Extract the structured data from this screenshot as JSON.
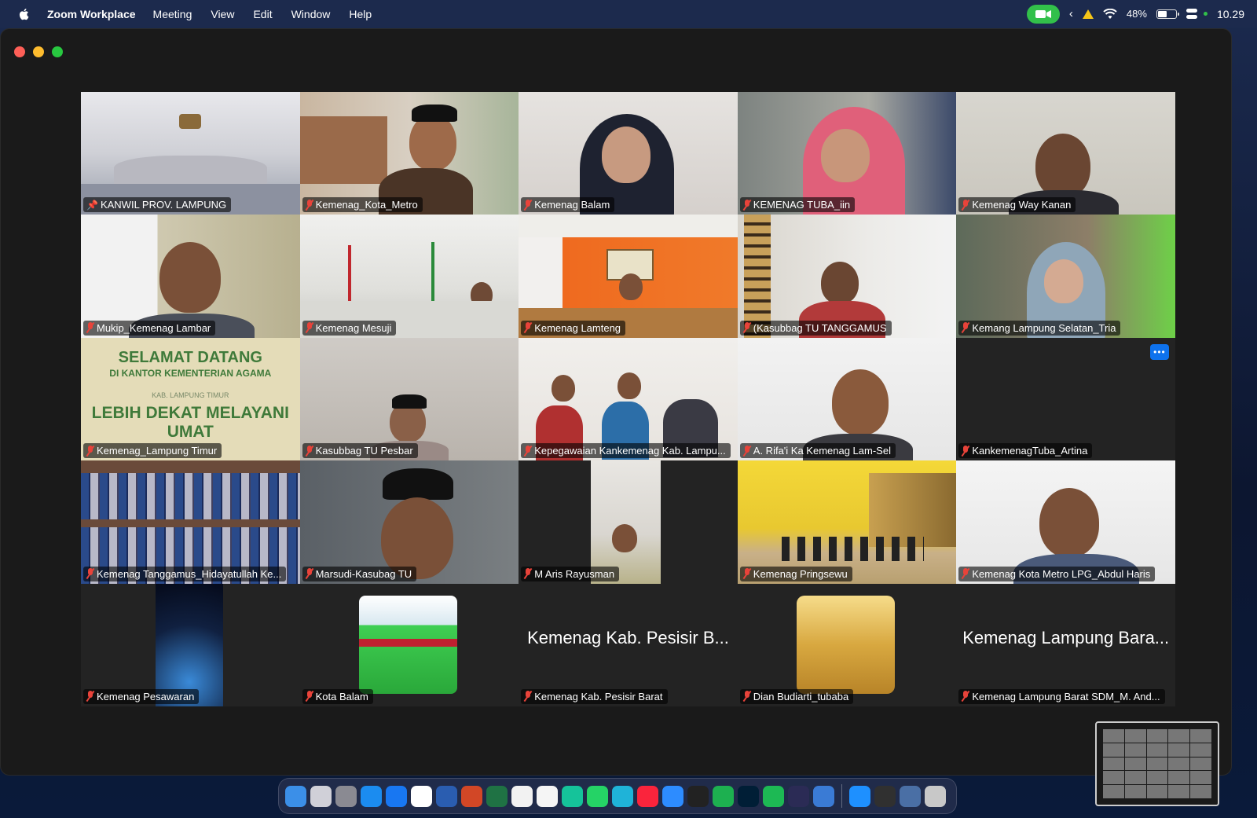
{
  "menubar": {
    "app_name": "Zoom Workplace",
    "items": [
      "Meeting",
      "View",
      "Edit",
      "Window",
      "Help"
    ],
    "battery": "48%",
    "time": "10.29"
  },
  "participants": [
    {
      "name": "KANWIL PROV. LAMPUNG",
      "pinned": true,
      "muted": false,
      "active": true
    },
    {
      "name": "Kemenag_Kota_Metro",
      "muted": true
    },
    {
      "name": "Kemenag Balam",
      "muted": true
    },
    {
      "name": "KEMENAG TUBA_iin",
      "muted": true
    },
    {
      "name": "Kemenag Way Kanan",
      "muted": true
    },
    {
      "name": "Mukip_Kemenag Lambar",
      "muted": true
    },
    {
      "name": "Kemenag Mesuji",
      "muted": true
    },
    {
      "name": "Kemenag Lamteng",
      "muted": true
    },
    {
      "name": "(Kasubbag TU TANGGAMUS",
      "muted": true
    },
    {
      "name": "Kemang Lampung Selatan_Tria",
      "muted": true
    },
    {
      "name": "Kemenag_Lampung Timur",
      "muted": true,
      "banner": [
        "SELAMAT DATANG",
        "DI KANTOR KEMENTERIAN AGAMA",
        "KAB. LAMPUNG TIMUR",
        "LEBIH DEKAT MELAYANI UMAT"
      ]
    },
    {
      "name": "Kasubbag TU Pesbar",
      "muted": true
    },
    {
      "name": "Kepegawaian Kankemenag Kab. Lampu...",
      "muted": true
    },
    {
      "name": "A. Rifa'i Ka Kemenag Lam-Sel",
      "muted": true
    },
    {
      "name": "KankemenagTuba_Artina",
      "muted": true,
      "more": "•••"
    },
    {
      "name": "Kemenag Tanggamus_Hidayatullah Ke...",
      "muted": true
    },
    {
      "name": "Marsudi-Kasubag TU",
      "muted": true
    },
    {
      "name": "M Aris Rayusman",
      "muted": true
    },
    {
      "name": "Kemenag Pringsewu",
      "muted": true
    },
    {
      "name": "Kemenag Kota Metro LPG_Abdul Haris",
      "muted": true
    },
    {
      "name": "Kemenag Pesawaran",
      "muted": true
    },
    {
      "name": "Kota Balam",
      "muted": true
    },
    {
      "name": "Kemenag Kab. Pesisir Barat",
      "muted": true,
      "big_label": "Kemenag Kab. Pesisir B..."
    },
    {
      "name": "Dian Budiarti_tubaba",
      "muted": true
    },
    {
      "name": "Kemenag Lampung Barat SDM_M. And...",
      "muted": true,
      "big_label": "Kemenag Lampung Bara..."
    }
  ],
  "dock": {
    "icons": [
      "finder-icon",
      "launchpad-icon",
      "settings-icon",
      "app-store-icon",
      "safari-icon",
      "chrome-icon",
      "word-icon",
      "powerpoint-icon",
      "excel-icon",
      "notes-icon",
      "photos-icon",
      "grammarly-icon",
      "whatsapp-icon",
      "canva-icon",
      "music-icon",
      "zoom-icon",
      "terminal-icon",
      "numbers-icon",
      "photoshop-icon",
      "spotify-icon",
      "vectornator-icon",
      "preview-icon",
      "folder-icon",
      "screenshot-icon",
      "windows-icon",
      "trash-icon"
    ],
    "colors": [
      "#3b8fe8",
      "#d0d0d8",
      "#8a8a92",
      "#1b8cf0",
      "#1877f2",
      "#ffffff",
      "#2a5db0",
      "#d24726",
      "#1f7244",
      "#f2f2f2",
      "#f5f5f5",
      "#15c39a",
      "#25d366",
      "#1fb3d8",
      "#fa243c",
      "#2d8cff",
      "#222222",
      "#1db050",
      "#001e36",
      "#1db954",
      "#2b2b55",
      "#3a7bd5",
      "#1e90ff",
      "#303030",
      "#4a6fa5",
      "#c8c8c8"
    ]
  }
}
